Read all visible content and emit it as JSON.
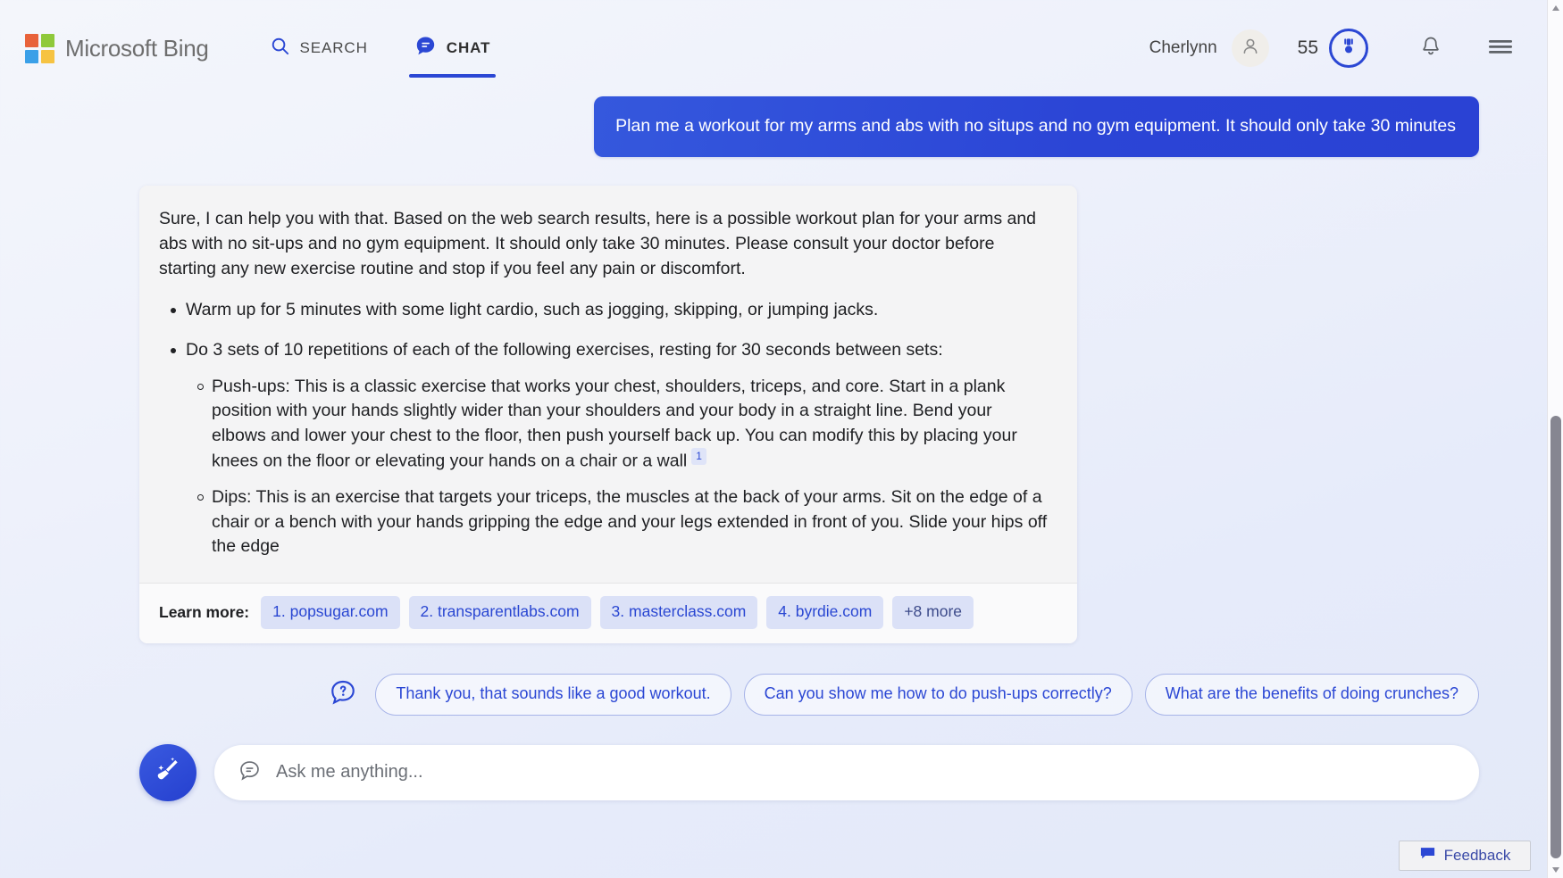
{
  "header": {
    "brand": "Microsoft Bing",
    "logo_colors": [
      "#e8623a",
      "#8fc93a",
      "#3aa0e8",
      "#f6c342"
    ],
    "tabs": [
      {
        "label": "SEARCH",
        "icon": "search-icon",
        "active": false
      },
      {
        "label": "CHAT",
        "icon": "chat-bubble-icon",
        "active": true
      }
    ],
    "user_name": "Cherlynn",
    "avatar_icon": "person-icon",
    "points": "55",
    "rewards_icon": "rewards-medal-icon",
    "notification_icon": "bell-icon",
    "menu_icon": "hamburger-menu-icon",
    "accent_color": "#2b47d4"
  },
  "conversation": {
    "user_message": "Plan me a workout for my arms and abs with no situps and no gym equipment. It should only take 30 minutes",
    "answer": {
      "intro": "Sure, I can help you with that. Based on the web search results, here is a possible workout plan for your arms and abs with no sit-ups and no gym equipment. It should only take 30 minutes. Please consult your doctor before starting any new exercise routine and stop if you feel any pain or discomfort.",
      "bullets": [
        {
          "text": "Warm up for 5 minutes with some light cardio, such as jogging, skipping, or jumping jacks.",
          "sub": []
        },
        {
          "text": "Do 3 sets of 10 repetitions of each of the following exercises, resting for 30 seconds between sets:",
          "sub": [
            {
              "text": "Push-ups: This is a classic exercise that works your chest, shoulders, triceps, and core. Start in a plank position with your hands slightly wider than your shoulders and your body in a straight line. Bend your elbows and lower your chest to the floor, then push yourself back up. You can modify this by placing your knees on the floor or elevating your hands on a chair or a wall",
              "citation": "1"
            },
            {
              "text": "Dips: This is an exercise that targets your triceps, the muscles at the back of your arms. Sit on the edge of a chair or a bench with your hands gripping the edge and your legs extended in front of you. Slide your hips off the edge",
              "citation": ""
            }
          ]
        }
      ],
      "learn_more_label": "Learn more:",
      "citations": [
        "1. popsugar.com",
        "2. transparentlabs.com",
        "3. masterclass.com",
        "4. byrdie.com"
      ],
      "citations_more": "+8 more"
    }
  },
  "suggestions": {
    "icon": "question-bubble-icon",
    "chips": [
      "Thank you, that sounds like a good workout.",
      "Can you show me how to do push-ups correctly?",
      "What are the benefits of doing crunches?"
    ]
  },
  "composer": {
    "new_topic_icon": "broom-new-topic-icon",
    "input_icon": "chat-bubble-outline-icon",
    "placeholder": "Ask me anything...",
    "value": ""
  },
  "feedback": {
    "label": "Feedback",
    "icon": "feedback-bubble-icon"
  },
  "scrollbar": {
    "up_icon": "scroll-up-arrow-icon",
    "down_icon": "scroll-down-arrow-icon"
  }
}
